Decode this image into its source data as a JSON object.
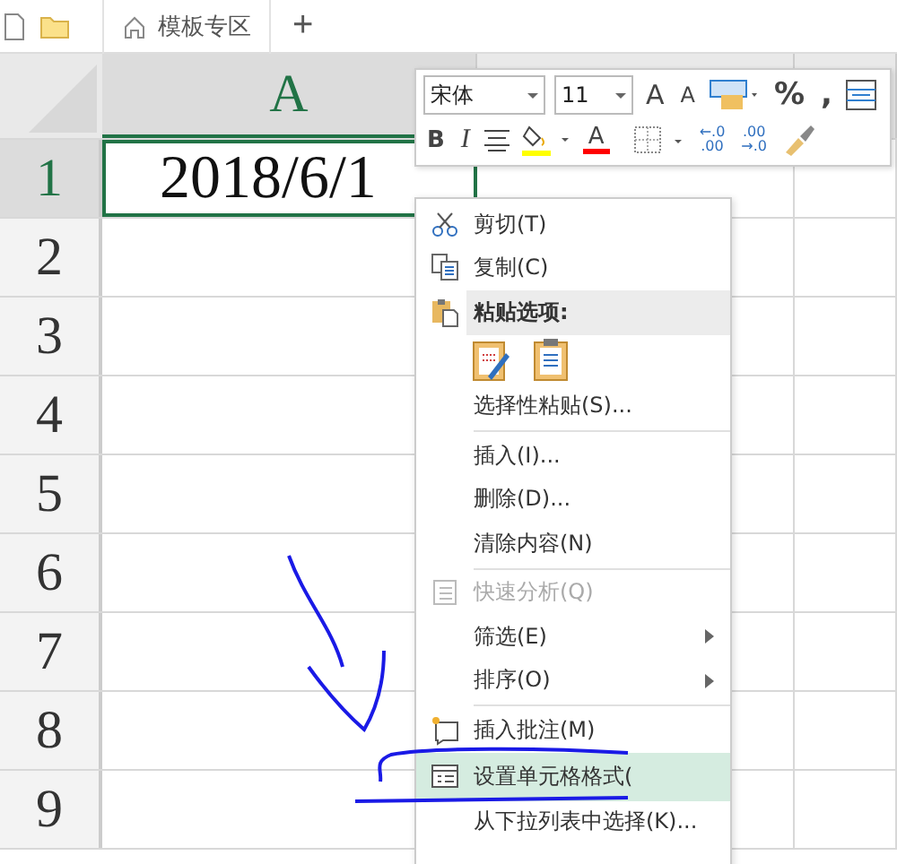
{
  "tab_bar": {
    "tab": "模板专区",
    "new_tab": "+"
  },
  "sheet": {
    "columns": [
      {
        "label": "A",
        "selected": true
      },
      {
        "selected": false
      }
    ],
    "rows": [
      {
        "label": "1",
        "selected": true
      },
      {
        "label": "2",
        "selected": false
      },
      {
        "label": "3",
        "selected": false
      },
      {
        "label": "4",
        "selected": false
      },
      {
        "label": "5",
        "selected": false
      },
      {
        "label": "6",
        "selected": false
      },
      {
        "label": "7",
        "selected": false
      },
      {
        "label": "8",
        "selected": false
      },
      {
        "label": "9",
        "selected": false
      }
    ],
    "cell_value": "2018/6/1"
  },
  "mini_toolbar": {
    "font": "宋体",
    "size": "11",
    "row_1": [
      {
        "kind": "grow",
        "label": "A"
      },
      {
        "kind": "shrink",
        "label": "A"
      },
      {
        "kind": "wrap"
      },
      {
        "kind": "text",
        "label": "%"
      },
      {
        "kind": "text",
        "label": ","
      },
      {
        "kind": "merge"
      }
    ],
    "row_2": [
      {
        "kind": "bold",
        "label": "B"
      },
      {
        "kind": "italic",
        "label": "I"
      },
      {
        "kind": "align"
      },
      {
        "kind": "fill",
        "color": "#ffff00"
      },
      {
        "kind": "fontcolor",
        "label": "A",
        "color": "#ff0000"
      },
      {
        "kind": "border"
      },
      {
        "kind": "decimal",
        "top": "←.0",
        "bottom": ".00"
      },
      {
        "kind": "decimal",
        "top": ".00",
        "bottom": "→.0"
      },
      {
        "kind": "brush"
      }
    ]
  },
  "context_menu": {
    "items": [
      {
        "kind": "cut",
        "label": "剪切(T)",
        "disabled": false,
        "submenu": false,
        "highlighted": false
      },
      {
        "kind": "copy",
        "label": "复制(C)",
        "disabled": false,
        "submenu": false,
        "highlighted": false
      },
      {
        "kind": "header",
        "label": "粘贴选项:"
      },
      {
        "kind": "paste-options"
      },
      {
        "kind": "item",
        "label": "选择性粘贴(S)...",
        "disabled": false,
        "submenu": false,
        "highlighted": false
      },
      {
        "kind": "separator"
      },
      {
        "kind": "item",
        "label": "插入(I)...",
        "disabled": false,
        "submenu": false,
        "highlighted": false
      },
      {
        "kind": "item",
        "label": "删除(D)...",
        "disabled": false,
        "submenu": false,
        "highlighted": false
      },
      {
        "kind": "item",
        "label": "清除内容(N)",
        "disabled": false,
        "submenu": false,
        "highlighted": false
      },
      {
        "kind": "separator"
      },
      {
        "kind": "analysis",
        "label": "快速分析(Q)",
        "disabled": true,
        "submenu": false,
        "highlighted": false
      },
      {
        "kind": "item",
        "label": "筛选(E)",
        "disabled": false,
        "submenu": true,
        "highlighted": false
      },
      {
        "kind": "item",
        "label": "排序(O)",
        "disabled": false,
        "submenu": true,
        "highlighted": false
      },
      {
        "kind": "separator"
      },
      {
        "kind": "comment",
        "label": "插入批注(M)",
        "disabled": false,
        "submenu": false,
        "highlighted": false
      },
      {
        "kind": "format",
        "label": "设置单元格格式(",
        "disabled": false,
        "submenu": false,
        "highlighted": true
      },
      {
        "kind": "item",
        "label": "从下拉列表中选择(K)...",
        "disabled": false,
        "submenu": false,
        "highlighted": false
      }
    ]
  }
}
